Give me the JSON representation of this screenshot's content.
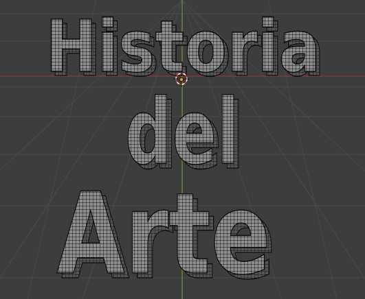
{
  "app": {
    "name": "3D viewport",
    "mode": "edit-mode-mesh-text"
  },
  "viewport": {
    "background_color": "#3d3d3d",
    "grid_color": "#4a4a4a",
    "axis_x_color": "#9b3b3b",
    "axis_y_color": "#6b9a3a",
    "mesh_face_color": "#8f8f8f",
    "mesh_wire_color": "#111111",
    "mesh_side_color": "#5a5a5a",
    "cursor_color_a": "#d83a2a",
    "cursor_color_b": "#ffffff",
    "origin_color": "#f29a2e"
  },
  "text_object": {
    "lines": [
      "Historia",
      "del",
      "Arte"
    ]
  },
  "icons": {
    "cursor": "3d-cursor-icon",
    "origin": "object-origin-icon"
  }
}
